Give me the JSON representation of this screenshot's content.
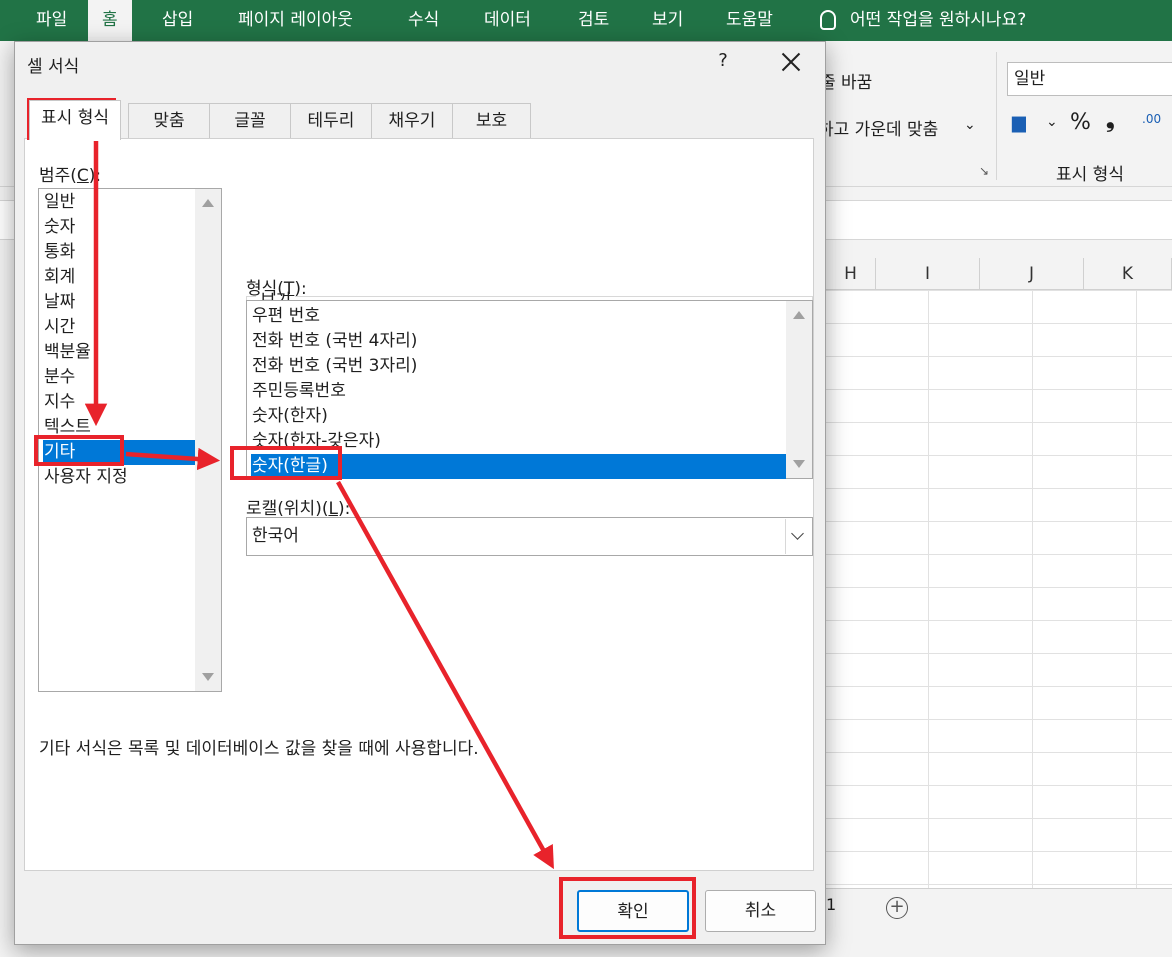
{
  "excel": {
    "ribbon_tabs": [
      "파일",
      "홈",
      "삽입",
      "페이지 레이아웃",
      "수식",
      "데이터",
      "검토",
      "보기",
      "도움말"
    ],
    "active_tab": "홈",
    "tell_me": "어떤 작업을 원하시나요?",
    "wrap_text": "줄 바꿈",
    "merge_center": "하고 가운데 맞춤",
    "number_format_value": "일반",
    "number_group_label": "표시 형식",
    "percent": "%",
    "comma": "❟",
    "decimal": ".00",
    "columns": [
      "H",
      "I",
      "J",
      "K"
    ],
    "sheet_tab_fragment": "1",
    "add_sheet": "+"
  },
  "dialog": {
    "title": "셀 서식",
    "help": "?",
    "tabs": [
      "표시 형식",
      "맞춤",
      "글꼴",
      "테두리",
      "채우기",
      "보호"
    ],
    "category_label": "범주(",
    "category_key": "C",
    "category_label_end": "):",
    "categories": [
      "일반",
      "숫자",
      "통화",
      "회계",
      "날짜",
      "시간",
      "백분율",
      "분수",
      "지수",
      "텍스트",
      "기타",
      "사용자 지정"
    ],
    "selected_category": "기타",
    "sample_label": "보기",
    "type_label": "형식(",
    "type_key": "T",
    "type_label_end": "):",
    "types": [
      "우편 번호",
      "전화 번호 (국번 4자리)",
      "전화 번호 (국번 3자리)",
      "주민등록번호",
      "숫자(한자)",
      "숫자(한자-갖은자)",
      "숫자(한글)"
    ],
    "selected_type": "숫자(한글)",
    "locale_label": "로캘(위치)(",
    "locale_key": "L",
    "locale_label_end": "):",
    "locale_value": "한국어",
    "description": "기타 서식은 목록 및 데이터베이스 값을 찾을 때에 사용합니다.",
    "ok": "확인",
    "cancel": "취소"
  },
  "colors": {
    "excel_green": "#217346",
    "selection_blue": "#0078d7",
    "annotation_red": "#e8232b"
  }
}
